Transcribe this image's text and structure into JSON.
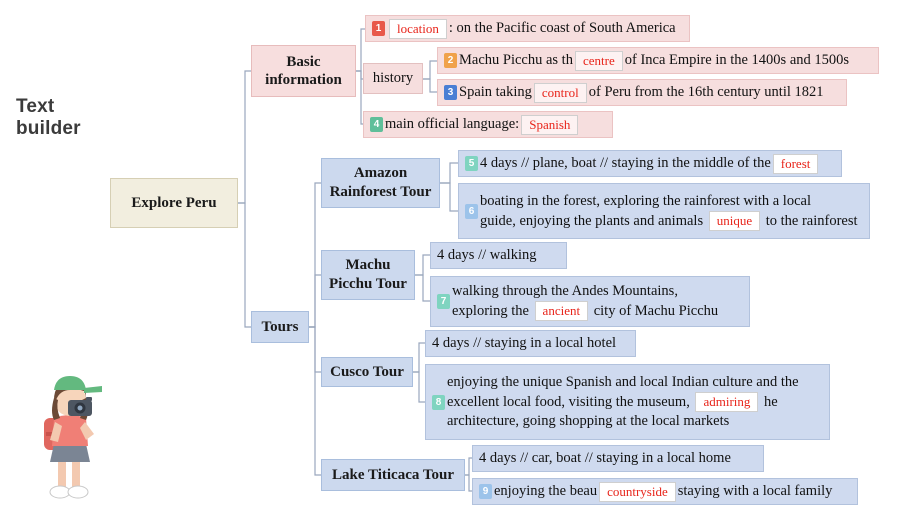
{
  "title": {
    "line1": "Text",
    "line2": "builder"
  },
  "root": {
    "label": "Explore Peru"
  },
  "categories": {
    "basic": "Basic information",
    "tours": "Tours"
  },
  "branches": {
    "basic": {
      "items": [
        {
          "num": "1",
          "num_color": "#e8584a",
          "text_before": ": on the Pacific coast of South America",
          "blank": "location"
        },
        {
          "num": "2",
          "num_color": "#f0a24a",
          "text": "Machu Picchu as the ___ of Inca Empire in the 1400s and 1500s",
          "blank": "centre"
        },
        {
          "num": "3",
          "num_color": "#4a7fd4",
          "text": "Spain taking ___ of Peru from the 16th century until 1821",
          "blank": "control"
        },
        {
          "num": "4",
          "num_color": "#5fbf9a",
          "text": "main official language: ___",
          "blank": "Spanish"
        }
      ],
      "history_label": "history"
    },
    "tours": [
      {
        "name": "Amazon Rainforest Tour",
        "lines": [
          {
            "num": "5",
            "text": "4 days // plane, boat // staying in the middle of the ___",
            "blank": "forest"
          },
          {
            "num": "6",
            "text": "boating in the forest, exploring the rainforest with a local guide, enjoying the plants and animals ___ to the rainforest",
            "blank": "unique"
          }
        ]
      },
      {
        "name": "Machu Picchu Tour",
        "lines": [
          {
            "num": "",
            "text": "4 days // walking",
            "blank": ""
          },
          {
            "num": "7",
            "text": "walking through the Andes Mountains, exploring the ___ city of Machu Picchu",
            "blank": "ancient"
          }
        ]
      },
      {
        "name": "Cusco Tour",
        "lines": [
          {
            "num": "",
            "text": "4 days // staying in a local hotel",
            "blank": ""
          },
          {
            "num": "8",
            "text": "enjoying the unique Spanish and local Indian culture and the excellent local food, visiting the museum, ___ the architecture, going shopping at the local markets",
            "blank": "admiring"
          }
        ]
      },
      {
        "name": "Lake Titicaca Tour",
        "lines": [
          {
            "num": "",
            "text": "4 days // car, boat // staying in a local home",
            "blank": ""
          },
          {
            "num": "9",
            "text": "enjoying the beautiful ___, staying with a local family",
            "blank": "countryside"
          }
        ]
      }
    ]
  },
  "leaf_text": {
    "location_rest": ": on the Pacific coast of South America",
    "centre_a": "Machu Picchu as th",
    "centre_b": "of Inca Empire in the 1400s and 1500s",
    "control_a": "Spain taking",
    "control_b": "of Peru from the 16th century until 1821",
    "language_a": "main official language:",
    "amazon1_a": "4 days // plane, boat // staying in the middle of the",
    "amazon2_a": "boating in the forest, exploring the rainforest with a local",
    "amazon2_b": "guide, enjoying the plants and animals",
    "amazon2_c": "to the rainforest",
    "machu1": "4 days // walking",
    "machu2_a": "walking through the Andes Mountains,",
    "machu2_b": "exploring the",
    "machu2_c": "city of Machu Picchu",
    "cusco1": "4 days // staying in a local hotel",
    "cusco2_a": "enjoying the unique Spanish and local Indian culture and the",
    "cusco2_b": "excellent local food, visiting the museum,",
    "cusco2_c": "he",
    "cusco2_d": "architecture, going shopping at the local markets",
    "titicaca1": "4 days // car, boat // staying in a local home",
    "titicaca2_a": "enjoying the beau",
    "titicaca2_b": "staying with a local family"
  },
  "blanks": {
    "location": "location",
    "centre": "centre",
    "control": "control",
    "spanish": "Spanish",
    "forest": "forest",
    "unique": "unique",
    "ancient": "ancient",
    "admiring": "admiring",
    "countryside": "countryside"
  },
  "numbers": {
    "n1": "1",
    "n2": "2",
    "n3": "3",
    "n4": "4",
    "n5": "5",
    "n6": "6",
    "n7": "7",
    "n8": "8",
    "n9": "9"
  },
  "colors": {
    "root_bg": "#f2eedf",
    "pink_bg": "#f7dede",
    "blue_bg": "#ccd9ee",
    "blank_text": "#e8241a",
    "line": "#9aa7bd"
  }
}
